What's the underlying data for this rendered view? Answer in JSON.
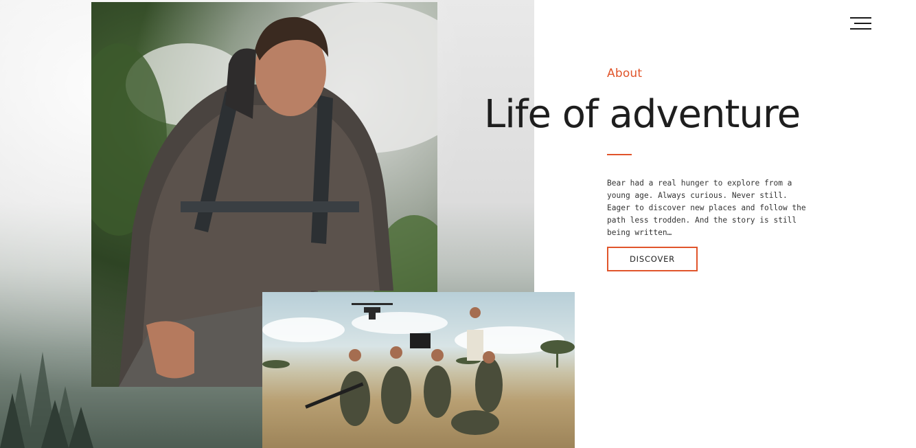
{
  "header": {
    "menu_icon": "hamburger-menu-icon"
  },
  "about": {
    "eyebrow": "About",
    "headline": "Life of adventure",
    "body": "Bear had a real hunger to explore from a young age. Always curious. Never still. Eager to discover new places and follow the path less trodden. And the story is still being written…",
    "cta_label": "DISCOVER"
  },
  "media": {
    "portrait_alt": "Portrait of Bear Grylls crouching in a misty forest",
    "team_alt": "Film crew with a drone kneeling in the savanna"
  },
  "colors": {
    "accent": "#e0542a",
    "text": "#1e1e1e"
  }
}
